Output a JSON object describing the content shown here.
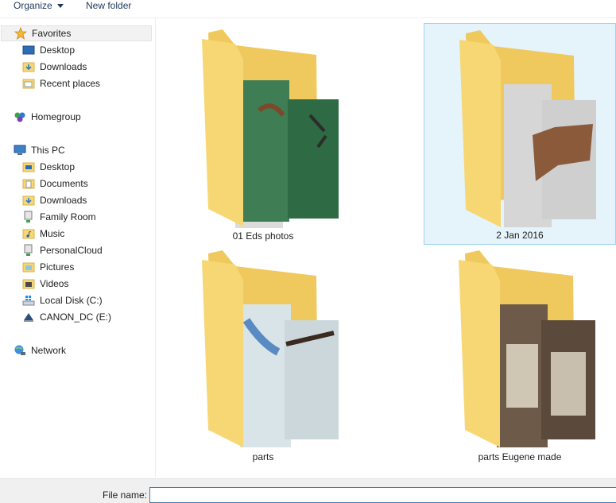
{
  "toolbar": {
    "organize_label": "Organize",
    "new_folder_label": "New folder"
  },
  "nav": {
    "favorites": {
      "label": "Favorites",
      "icon": "star-icon"
    },
    "favorites_items": [
      {
        "label": "Desktop",
        "icon": "desktop-icon"
      },
      {
        "label": "Downloads",
        "icon": "downloads-folder-icon"
      },
      {
        "label": "Recent places",
        "icon": "recent-places-icon"
      }
    ],
    "homegroup": {
      "label": "Homegroup",
      "icon": "homegroup-icon"
    },
    "thispc": {
      "label": "This PC",
      "icon": "computer-icon"
    },
    "thispc_items": [
      {
        "label": "Desktop",
        "icon": "desktop-folder-icon"
      },
      {
        "label": "Documents",
        "icon": "documents-folder-icon"
      },
      {
        "label": "Downloads",
        "icon": "downloads-folder-icon"
      },
      {
        "label": "Family Room",
        "icon": "network-drive-icon"
      },
      {
        "label": "Music",
        "icon": "music-folder-icon"
      },
      {
        "label": "PersonalCloud",
        "icon": "network-drive-icon"
      },
      {
        "label": "Pictures",
        "icon": "pictures-folder-icon"
      },
      {
        "label": "Videos",
        "icon": "videos-folder-icon"
      },
      {
        "label": "Local Disk (C:)",
        "icon": "local-disk-icon"
      },
      {
        "label": "CANON_DC (E:)",
        "icon": "removable-drive-icon"
      }
    ],
    "network": {
      "label": "Network",
      "icon": "network-icon"
    }
  },
  "folders": [
    {
      "name": "01 Eds photos",
      "selected": false
    },
    {
      "name": "2 Jan 2016",
      "selected": true
    },
    {
      "name": "parts",
      "selected": false
    },
    {
      "name": "parts Eugene made",
      "selected": false
    }
  ],
  "bottom": {
    "file_name_label": "File name:",
    "file_name_value": ""
  },
  "colors": {
    "folder": "#f7d774",
    "folder_dark": "#e8bf55",
    "selection_bg": "#e5f3fb",
    "selection_border": "#9fd3f0",
    "link": "#1e395b"
  }
}
